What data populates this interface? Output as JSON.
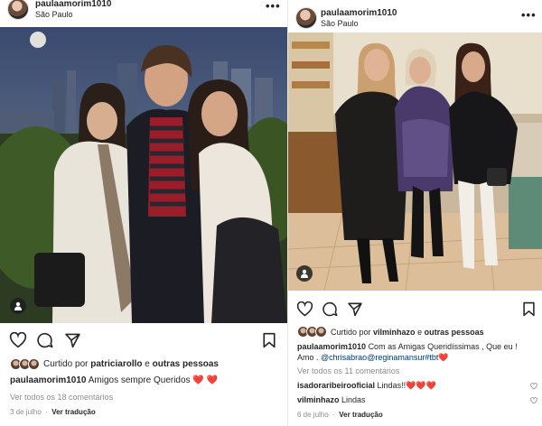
{
  "post_left": {
    "username": "paulaamorim1010",
    "location": "São Paulo",
    "likes_prefix": "Curtido por",
    "likes_user": "patriciarollo",
    "likes_and": "e",
    "likes_others": "outras pessoas",
    "caption_user": "paulaamorim1010",
    "caption_text": "Amigos sempre Queridos ❤️ ❤️",
    "view_comments": "Ver todos os 18 comentários",
    "date": "3 de julho",
    "translate": "Ver tradução"
  },
  "post_right": {
    "username": "paulaamorim1010",
    "location": "São Paulo",
    "likes_prefix": "Curtido por",
    "likes_user": "vilminhazo",
    "likes_and": "e",
    "likes_others": "outras pessoas",
    "caption_user": "paulaamorim1010",
    "caption_line1": "Com as Amigas Queridíssimas , Que eu !",
    "caption_line2_a": "Amo .",
    "caption_line2_b": "@chrisabrao@reginamansur#tbt❤️",
    "view_comments": "Ver todos os 11 comentários",
    "comments": [
      {
        "user": "isadoraribeirooficial",
        "text": "Lindas!!❤️❤️❤️"
      },
      {
        "user": "vilminhazo",
        "text": "Lindas"
      }
    ],
    "date": "6 de julho",
    "translate": "Ver tradução"
  },
  "colors": {
    "text": "#262626",
    "muted": "#8e8e8e",
    "link": "#00376b",
    "heart": "#e0252e"
  },
  "icons": [
    "more-icon",
    "tag-people-icon",
    "like-icon",
    "comment-icon",
    "share-icon",
    "save-icon",
    "comment-like-icon"
  ]
}
